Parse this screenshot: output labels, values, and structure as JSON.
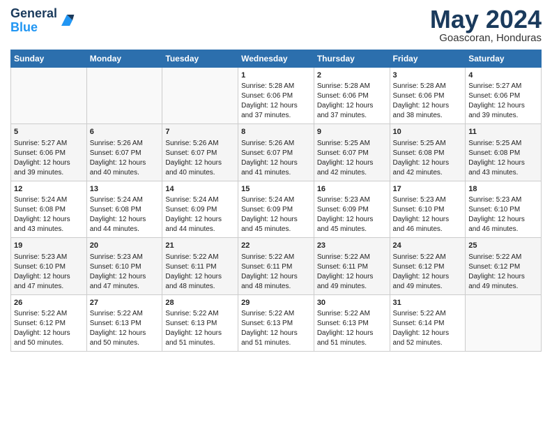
{
  "logo": {
    "line1": "General",
    "line2": "Blue"
  },
  "title": "May 2024",
  "subtitle": "Goascoran, Honduras",
  "days_header": [
    "Sunday",
    "Monday",
    "Tuesday",
    "Wednesday",
    "Thursday",
    "Friday",
    "Saturday"
  ],
  "weeks": [
    [
      {
        "day": "",
        "lines": []
      },
      {
        "day": "",
        "lines": []
      },
      {
        "day": "",
        "lines": []
      },
      {
        "day": "1",
        "lines": [
          "Sunrise: 5:28 AM",
          "Sunset: 6:06 PM",
          "Daylight: 12 hours",
          "and 37 minutes."
        ]
      },
      {
        "day": "2",
        "lines": [
          "Sunrise: 5:28 AM",
          "Sunset: 6:06 PM",
          "Daylight: 12 hours",
          "and 37 minutes."
        ]
      },
      {
        "day": "3",
        "lines": [
          "Sunrise: 5:28 AM",
          "Sunset: 6:06 PM",
          "Daylight: 12 hours",
          "and 38 minutes."
        ]
      },
      {
        "day": "4",
        "lines": [
          "Sunrise: 5:27 AM",
          "Sunset: 6:06 PM",
          "Daylight: 12 hours",
          "and 39 minutes."
        ]
      }
    ],
    [
      {
        "day": "5",
        "lines": [
          "Sunrise: 5:27 AM",
          "Sunset: 6:06 PM",
          "Daylight: 12 hours",
          "and 39 minutes."
        ]
      },
      {
        "day": "6",
        "lines": [
          "Sunrise: 5:26 AM",
          "Sunset: 6:07 PM",
          "Daylight: 12 hours",
          "and 40 minutes."
        ]
      },
      {
        "day": "7",
        "lines": [
          "Sunrise: 5:26 AM",
          "Sunset: 6:07 PM",
          "Daylight: 12 hours",
          "and 40 minutes."
        ]
      },
      {
        "day": "8",
        "lines": [
          "Sunrise: 5:26 AM",
          "Sunset: 6:07 PM",
          "Daylight: 12 hours",
          "and 41 minutes."
        ]
      },
      {
        "day": "9",
        "lines": [
          "Sunrise: 5:25 AM",
          "Sunset: 6:07 PM",
          "Daylight: 12 hours",
          "and 42 minutes."
        ]
      },
      {
        "day": "10",
        "lines": [
          "Sunrise: 5:25 AM",
          "Sunset: 6:08 PM",
          "Daylight: 12 hours",
          "and 42 minutes."
        ]
      },
      {
        "day": "11",
        "lines": [
          "Sunrise: 5:25 AM",
          "Sunset: 6:08 PM",
          "Daylight: 12 hours",
          "and 43 minutes."
        ]
      }
    ],
    [
      {
        "day": "12",
        "lines": [
          "Sunrise: 5:24 AM",
          "Sunset: 6:08 PM",
          "Daylight: 12 hours",
          "and 43 minutes."
        ]
      },
      {
        "day": "13",
        "lines": [
          "Sunrise: 5:24 AM",
          "Sunset: 6:08 PM",
          "Daylight: 12 hours",
          "and 44 minutes."
        ]
      },
      {
        "day": "14",
        "lines": [
          "Sunrise: 5:24 AM",
          "Sunset: 6:09 PM",
          "Daylight: 12 hours",
          "and 44 minutes."
        ]
      },
      {
        "day": "15",
        "lines": [
          "Sunrise: 5:24 AM",
          "Sunset: 6:09 PM",
          "Daylight: 12 hours",
          "and 45 minutes."
        ]
      },
      {
        "day": "16",
        "lines": [
          "Sunrise: 5:23 AM",
          "Sunset: 6:09 PM",
          "Daylight: 12 hours",
          "and 45 minutes."
        ]
      },
      {
        "day": "17",
        "lines": [
          "Sunrise: 5:23 AM",
          "Sunset: 6:10 PM",
          "Daylight: 12 hours",
          "and 46 minutes."
        ]
      },
      {
        "day": "18",
        "lines": [
          "Sunrise: 5:23 AM",
          "Sunset: 6:10 PM",
          "Daylight: 12 hours",
          "and 46 minutes."
        ]
      }
    ],
    [
      {
        "day": "19",
        "lines": [
          "Sunrise: 5:23 AM",
          "Sunset: 6:10 PM",
          "Daylight: 12 hours",
          "and 47 minutes."
        ]
      },
      {
        "day": "20",
        "lines": [
          "Sunrise: 5:23 AM",
          "Sunset: 6:10 PM",
          "Daylight: 12 hours",
          "and 47 minutes."
        ]
      },
      {
        "day": "21",
        "lines": [
          "Sunrise: 5:22 AM",
          "Sunset: 6:11 PM",
          "Daylight: 12 hours",
          "and 48 minutes."
        ]
      },
      {
        "day": "22",
        "lines": [
          "Sunrise: 5:22 AM",
          "Sunset: 6:11 PM",
          "Daylight: 12 hours",
          "and 48 minutes."
        ]
      },
      {
        "day": "23",
        "lines": [
          "Sunrise: 5:22 AM",
          "Sunset: 6:11 PM",
          "Daylight: 12 hours",
          "and 49 minutes."
        ]
      },
      {
        "day": "24",
        "lines": [
          "Sunrise: 5:22 AM",
          "Sunset: 6:12 PM",
          "Daylight: 12 hours",
          "and 49 minutes."
        ]
      },
      {
        "day": "25",
        "lines": [
          "Sunrise: 5:22 AM",
          "Sunset: 6:12 PM",
          "Daylight: 12 hours",
          "and 49 minutes."
        ]
      }
    ],
    [
      {
        "day": "26",
        "lines": [
          "Sunrise: 5:22 AM",
          "Sunset: 6:12 PM",
          "Daylight: 12 hours",
          "and 50 minutes."
        ]
      },
      {
        "day": "27",
        "lines": [
          "Sunrise: 5:22 AM",
          "Sunset: 6:13 PM",
          "Daylight: 12 hours",
          "and 50 minutes."
        ]
      },
      {
        "day": "28",
        "lines": [
          "Sunrise: 5:22 AM",
          "Sunset: 6:13 PM",
          "Daylight: 12 hours",
          "and 51 minutes."
        ]
      },
      {
        "day": "29",
        "lines": [
          "Sunrise: 5:22 AM",
          "Sunset: 6:13 PM",
          "Daylight: 12 hours",
          "and 51 minutes."
        ]
      },
      {
        "day": "30",
        "lines": [
          "Sunrise: 5:22 AM",
          "Sunset: 6:13 PM",
          "Daylight: 12 hours",
          "and 51 minutes."
        ]
      },
      {
        "day": "31",
        "lines": [
          "Sunrise: 5:22 AM",
          "Sunset: 6:14 PM",
          "Daylight: 12 hours",
          "and 52 minutes."
        ]
      },
      {
        "day": "",
        "lines": []
      }
    ]
  ]
}
